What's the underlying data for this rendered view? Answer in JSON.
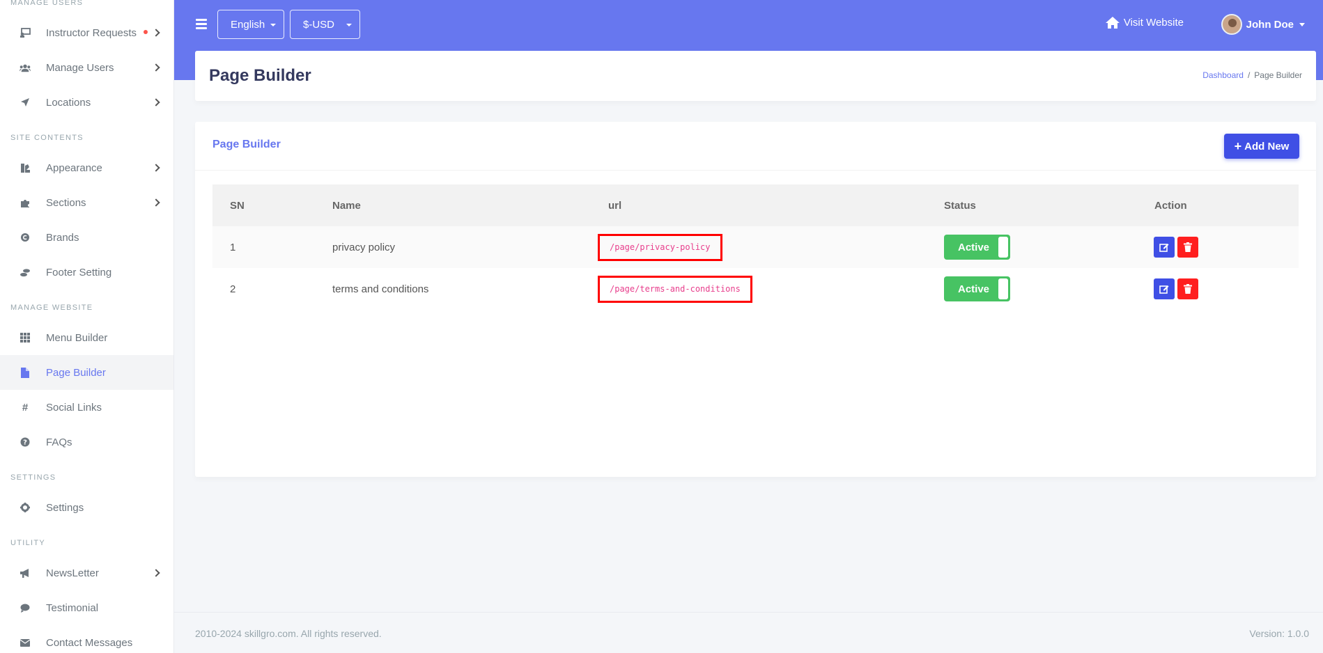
{
  "sidebar": {
    "sections": {
      "manage_users": "MANAGE USERS",
      "site_contents": "SITE CONTENTS",
      "manage_website": "MANAGE WEBSITE",
      "settings": "SETTINGS",
      "utility": "UTILITY"
    },
    "items": {
      "instructor_requests": "Instructor Requests",
      "manage_users": "Manage Users",
      "locations": "Locations",
      "appearance": "Appearance",
      "sections": "Sections",
      "brands": "Brands",
      "footer_setting": "Footer Setting",
      "menu_builder": "Menu Builder",
      "page_builder": "Page Builder",
      "social_links": "Social Links",
      "faqs": "FAQs",
      "settings": "Settings",
      "newsletter": "NewsLetter",
      "testimonial": "Testimonial",
      "contact_messages": "Contact Messages"
    }
  },
  "topbar": {
    "language": "English",
    "currency": "$-USD",
    "visit_website": "Visit Website",
    "user_name": "John Doe"
  },
  "header": {
    "title": "Page Builder",
    "breadcrumb_home": "Dashboard",
    "breadcrumb_current": "Page Builder"
  },
  "card": {
    "title": "Page Builder",
    "add_button": "Add New"
  },
  "table": {
    "headers": {
      "sn": "SN",
      "name": "Name",
      "url": "url",
      "status": "Status",
      "action": "Action"
    },
    "rows": [
      {
        "sn": "1",
        "name": "privacy policy",
        "url": "/page/privacy-policy",
        "status": "Active"
      },
      {
        "sn": "2",
        "name": "terms and conditions",
        "url": "/page/terms-and-conditions",
        "status": "Active"
      }
    ]
  },
  "footer": {
    "copyright": "2010-2024 skillgro.com. All rights reserved.",
    "version": "Version: 1.0.0"
  },
  "colors": {
    "primary": "#6777ef",
    "success": "#47c363",
    "danger": "#ff1f1f",
    "button_blue": "#3f4fe5"
  }
}
